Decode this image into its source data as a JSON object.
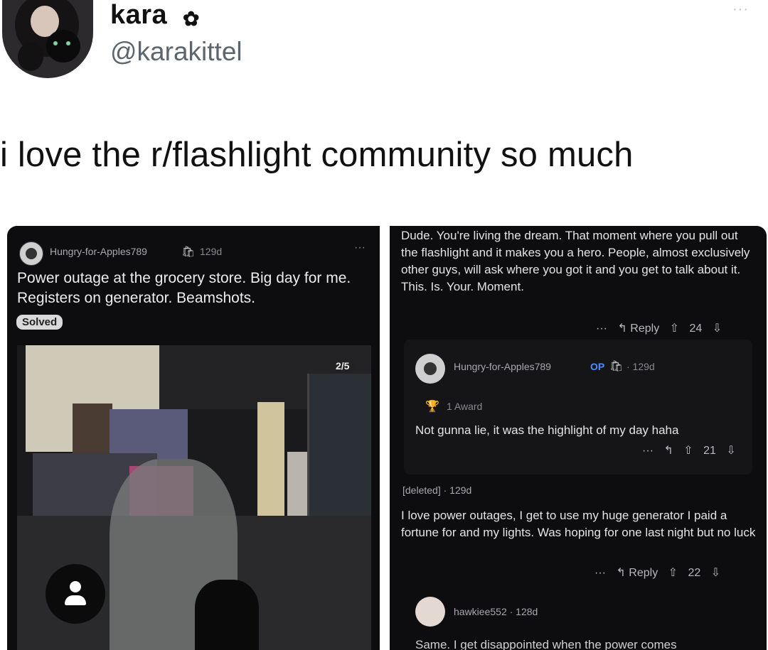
{
  "tweet": {
    "display_name": "kara",
    "name_icon": "flower-icon",
    "handle": "@karakittel",
    "more": "···",
    "text": "i love the r/flashlight community so much"
  },
  "post": {
    "username": "Hungry-for-Apples789",
    "age": "129d",
    "title": "Power outage at the grocery store. Big day for me. Registers on generator. Beamshots.",
    "flair": "Solved",
    "image_counter": "2/5",
    "more": "···"
  },
  "comments": [
    {
      "text": "Dude. You're living the dream.  That moment where you pull out the flashlight and it makes you a hero. People, almost exclusively other guys, will ask where you got it and you get to talk about it.  This. Is. Your. Moment.",
      "dots": "···",
      "reply": "↰ Reply",
      "votes": "24"
    },
    {
      "username": "Hungry-for-Apples789",
      "op": "OP",
      "age": "· 129d",
      "award": "1 Award",
      "text": "Not gunna lie, it was the highlight of my day haha",
      "dots": "···",
      "reply": "↰",
      "votes": "21"
    },
    {
      "meta": "[deleted] · 129d",
      "text": "I love power outages, I get to use my huge generator I paid a fortune for and my lights. Was hoping for one last night but no luck",
      "dots": "···",
      "reply": "↰ Reply",
      "votes": "22"
    },
    {
      "username": "hawkiee552 · 128d",
      "text": "Same. I get disappointed when the power comes"
    }
  ]
}
